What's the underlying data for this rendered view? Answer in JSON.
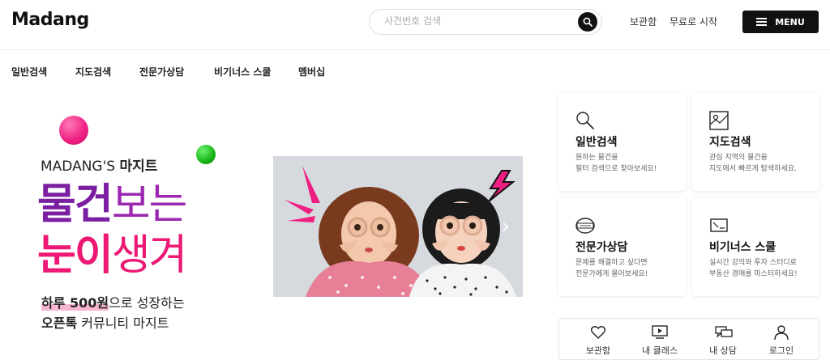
{
  "header": {
    "logo": "Madang",
    "search_placeholder": "사건번호 검색",
    "links": [
      "보관함",
      "무료로 시작"
    ],
    "menu_label": "MENU"
  },
  "nav": [
    "일반검색",
    "지도검색",
    "전문가상담",
    "비기너스 스쿨",
    "멤버십"
  ],
  "hero": {
    "brand_prefix": "MADANG'S ",
    "brand_name": "마지트",
    "line1_strong": "물건",
    "line1_light": "보는",
    "line2_strong": "눈이",
    "line2_light": "생겨",
    "tagline1_highlight": "하루 500원",
    "tagline1_rest": "으로 성장하는",
    "tagline2_strong": "오픈톡",
    "tagline2_rest": " 커뮤니티 마지트"
  },
  "cards": [
    {
      "icon": "search-icon",
      "title": "일반검색",
      "desc1": "원하는 물건을",
      "desc2": "필터 검색으로 찾아보세요!"
    },
    {
      "icon": "map-icon",
      "title": "지도검색",
      "desc1": "관심 지역의 물건을",
      "desc2": "지도에서 빠르게 탐색하세요."
    },
    {
      "icon": "expert-badge-icon",
      "title": "전문가상담",
      "desc1": "문제를 해결하고 싶다면",
      "desc2": "전문가에게 물어보세요!"
    },
    {
      "icon": "chalkboard-icon",
      "title": "비기너스 스쿨",
      "desc1": "실시간 강의와 투자 스터디로",
      "desc2": "부동산 경매를 마스터하세요!"
    }
  ],
  "bottom_bar": [
    {
      "icon": "heart-icon",
      "label": "보관함"
    },
    {
      "icon": "video-screen-icon",
      "label": "내 클래스"
    },
    {
      "icon": "chat-bubbles-icon",
      "label": "내 상담"
    },
    {
      "icon": "person-icon",
      "label": "로그인"
    }
  ],
  "colors": {
    "purple": "#7b1fa2",
    "pink": "#ec1874",
    "green": "#17b517",
    "dark": "#111111"
  }
}
